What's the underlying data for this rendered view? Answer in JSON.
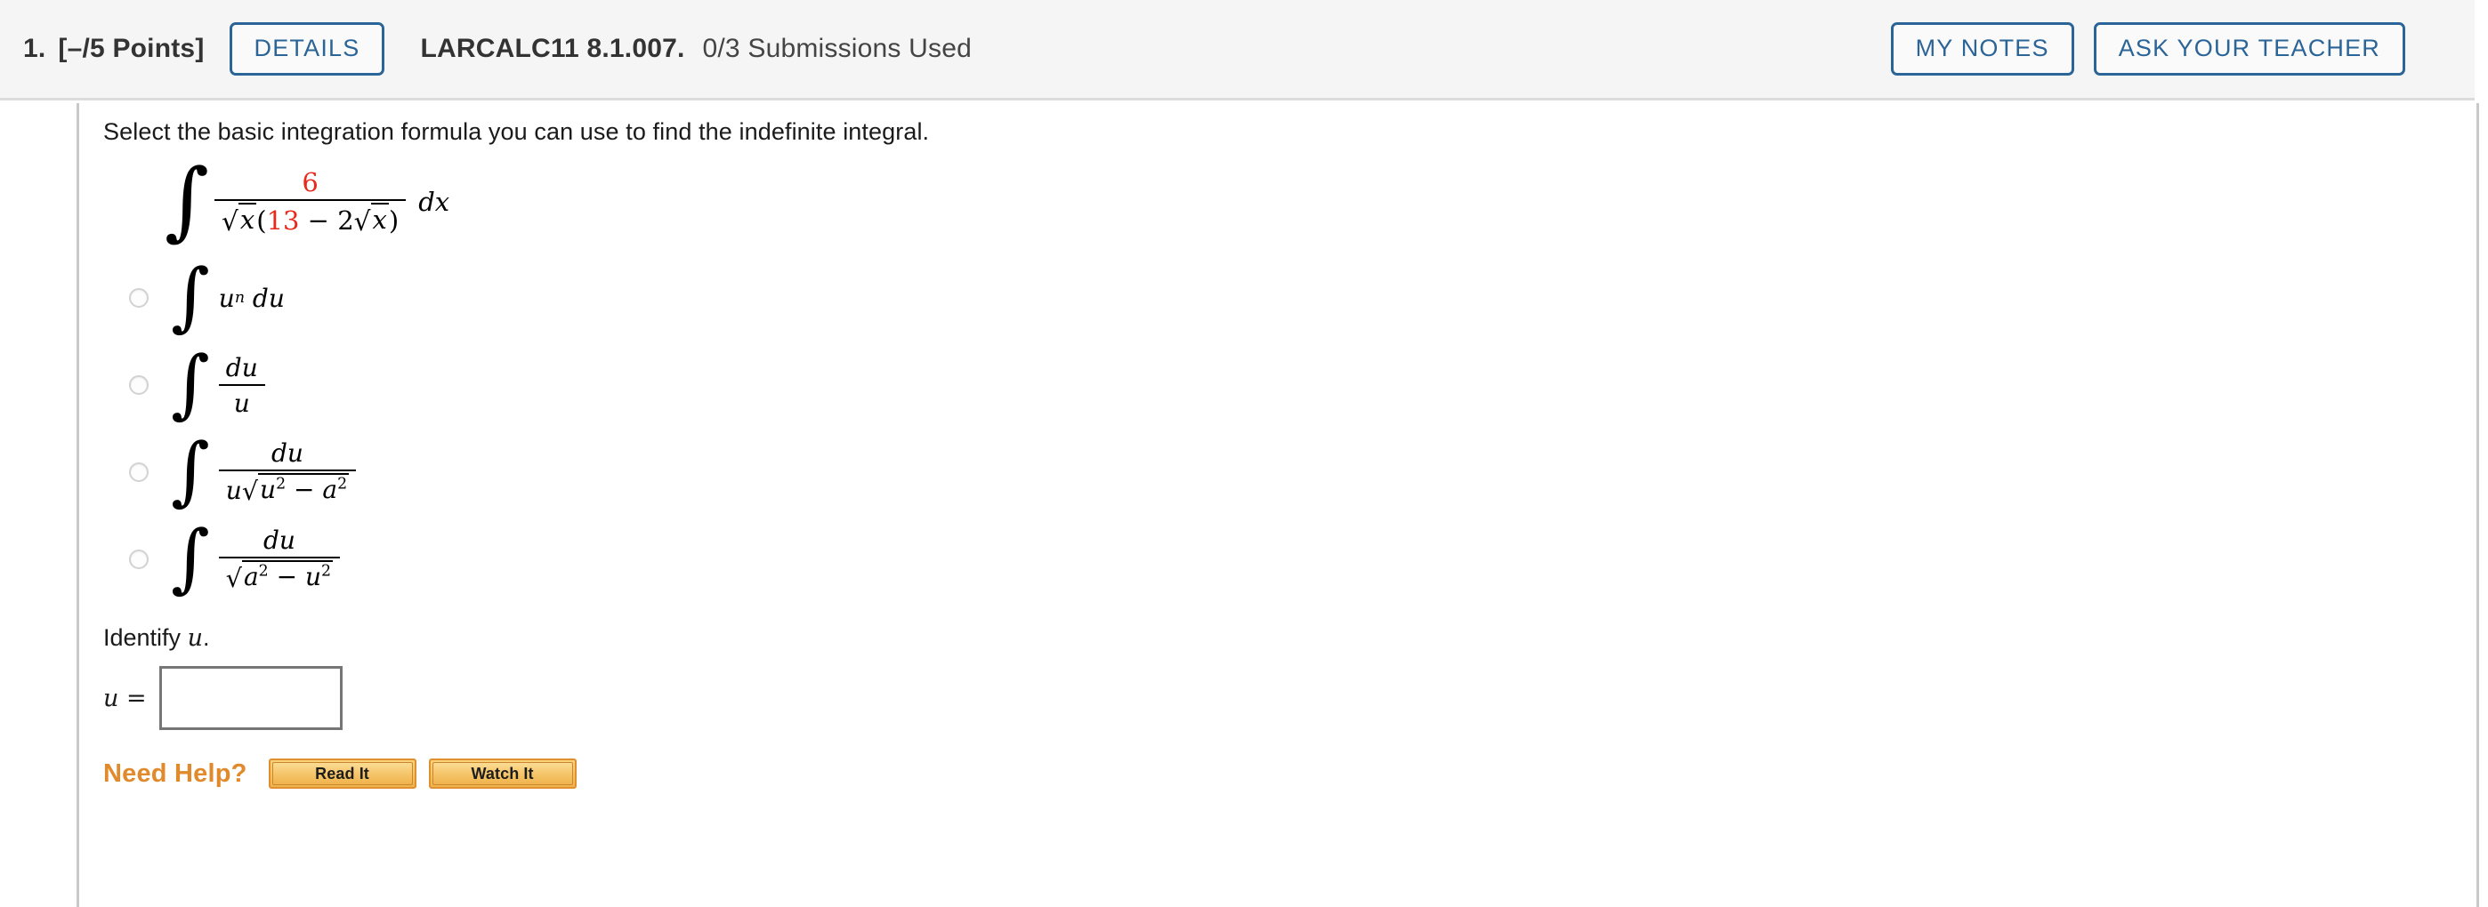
{
  "header": {
    "question_number": "1.",
    "points": "[–/5 Points]",
    "details_button": "DETAILS",
    "assignment_code": "LARCALC11 8.1.007.",
    "submissions": "0/3 Submissions Used",
    "my_notes_button": "MY NOTES",
    "ask_teacher_button": "ASK YOUR TEACHER",
    "accent_color": "#2b6496",
    "background": "#f5f5f5"
  },
  "question": {
    "prompt": "Select the basic integration formula you can use to find the indefinite integral.",
    "integral": {
      "numerator": "6",
      "denominator_sqrt_var": "x",
      "denominator_constant": "13",
      "denominator_coefficient": "2",
      "denominator_sqrt_var2": "x",
      "differential": "dx",
      "highlight_color": "#e8291c"
    }
  },
  "options": [
    {
      "id": "opt-un-du",
      "latex": "∫ u^n du",
      "selected": false
    },
    {
      "id": "opt-du-over-u",
      "latex": "∫ du/u",
      "selected": false
    },
    {
      "id": "opt-du-u-sqrt",
      "latex": "∫ du/(u√(u²−a²))",
      "selected": false
    },
    {
      "id": "opt-du-sqrt-a2u2",
      "latex": "∫ du/√(a²−u²)",
      "selected": false
    }
  ],
  "identify": {
    "label_text": "Identify ",
    "label_var": "u",
    "label_period": ".",
    "field_prefix": "u =",
    "field_value": "",
    "field_placeholder": ""
  },
  "need_help": {
    "label": "Need Help?",
    "label_color": "#e08a2b",
    "buttons": [
      {
        "name": "read-it",
        "label": "Read It"
      },
      {
        "name": "watch-it",
        "label": "Watch It"
      }
    ]
  }
}
